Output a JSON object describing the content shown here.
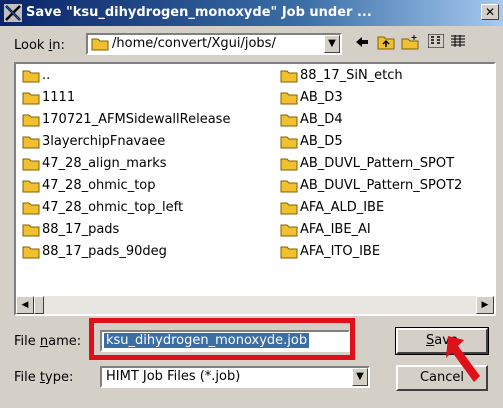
{
  "window": {
    "title": "Save \"ksu_dihydrogen_monoxyde\" Job under ..."
  },
  "lookin": {
    "label_pre": "Look ",
    "label_u": "i",
    "label_post": "n:",
    "path": "/home/convert/Xgui/jobs/"
  },
  "toolbar": {
    "back_icon": "back-arrow-icon",
    "up_icon": "up-folder-icon",
    "new_icon": "new-folder-icon",
    "list_icon": "list-view-icon",
    "details_icon": "details-view-icon"
  },
  "files": {
    "col1": [
      "..",
      "1111",
      "170721_AFMSidewallRelease",
      "3layerchipFnavaee",
      "47_28_align_marks",
      "47_28_ohmic_top",
      "47_28_ohmic_top_left",
      "88_17_pads",
      "88_17_pads_90deg"
    ],
    "col2": [
      "88_17_SiN_etch",
      "AB_D3",
      "AB_D4",
      "AB_D5",
      "AB_DUVL_Pattern_SPOT",
      "AB_DUVL_Pattern_SPOT2",
      "AFA_ALD_IBE",
      "AFA_IBE_AI",
      "AFA_ITO_IBE"
    ]
  },
  "filename": {
    "label_pre": "File ",
    "label_u": "n",
    "label_post": "ame:",
    "value": "ksu_dihydrogen_monoxyde.job"
  },
  "filetype": {
    "label_pre": "File ",
    "label_u": "t",
    "label_post": "ype:",
    "value": "HIMT Job Files (*.job)"
  },
  "buttons": {
    "save_u": "S",
    "save_rest": "ave",
    "cancel": "Cancel"
  },
  "colors": {
    "highlight": "#e0101a",
    "folder": "#f0c030"
  }
}
